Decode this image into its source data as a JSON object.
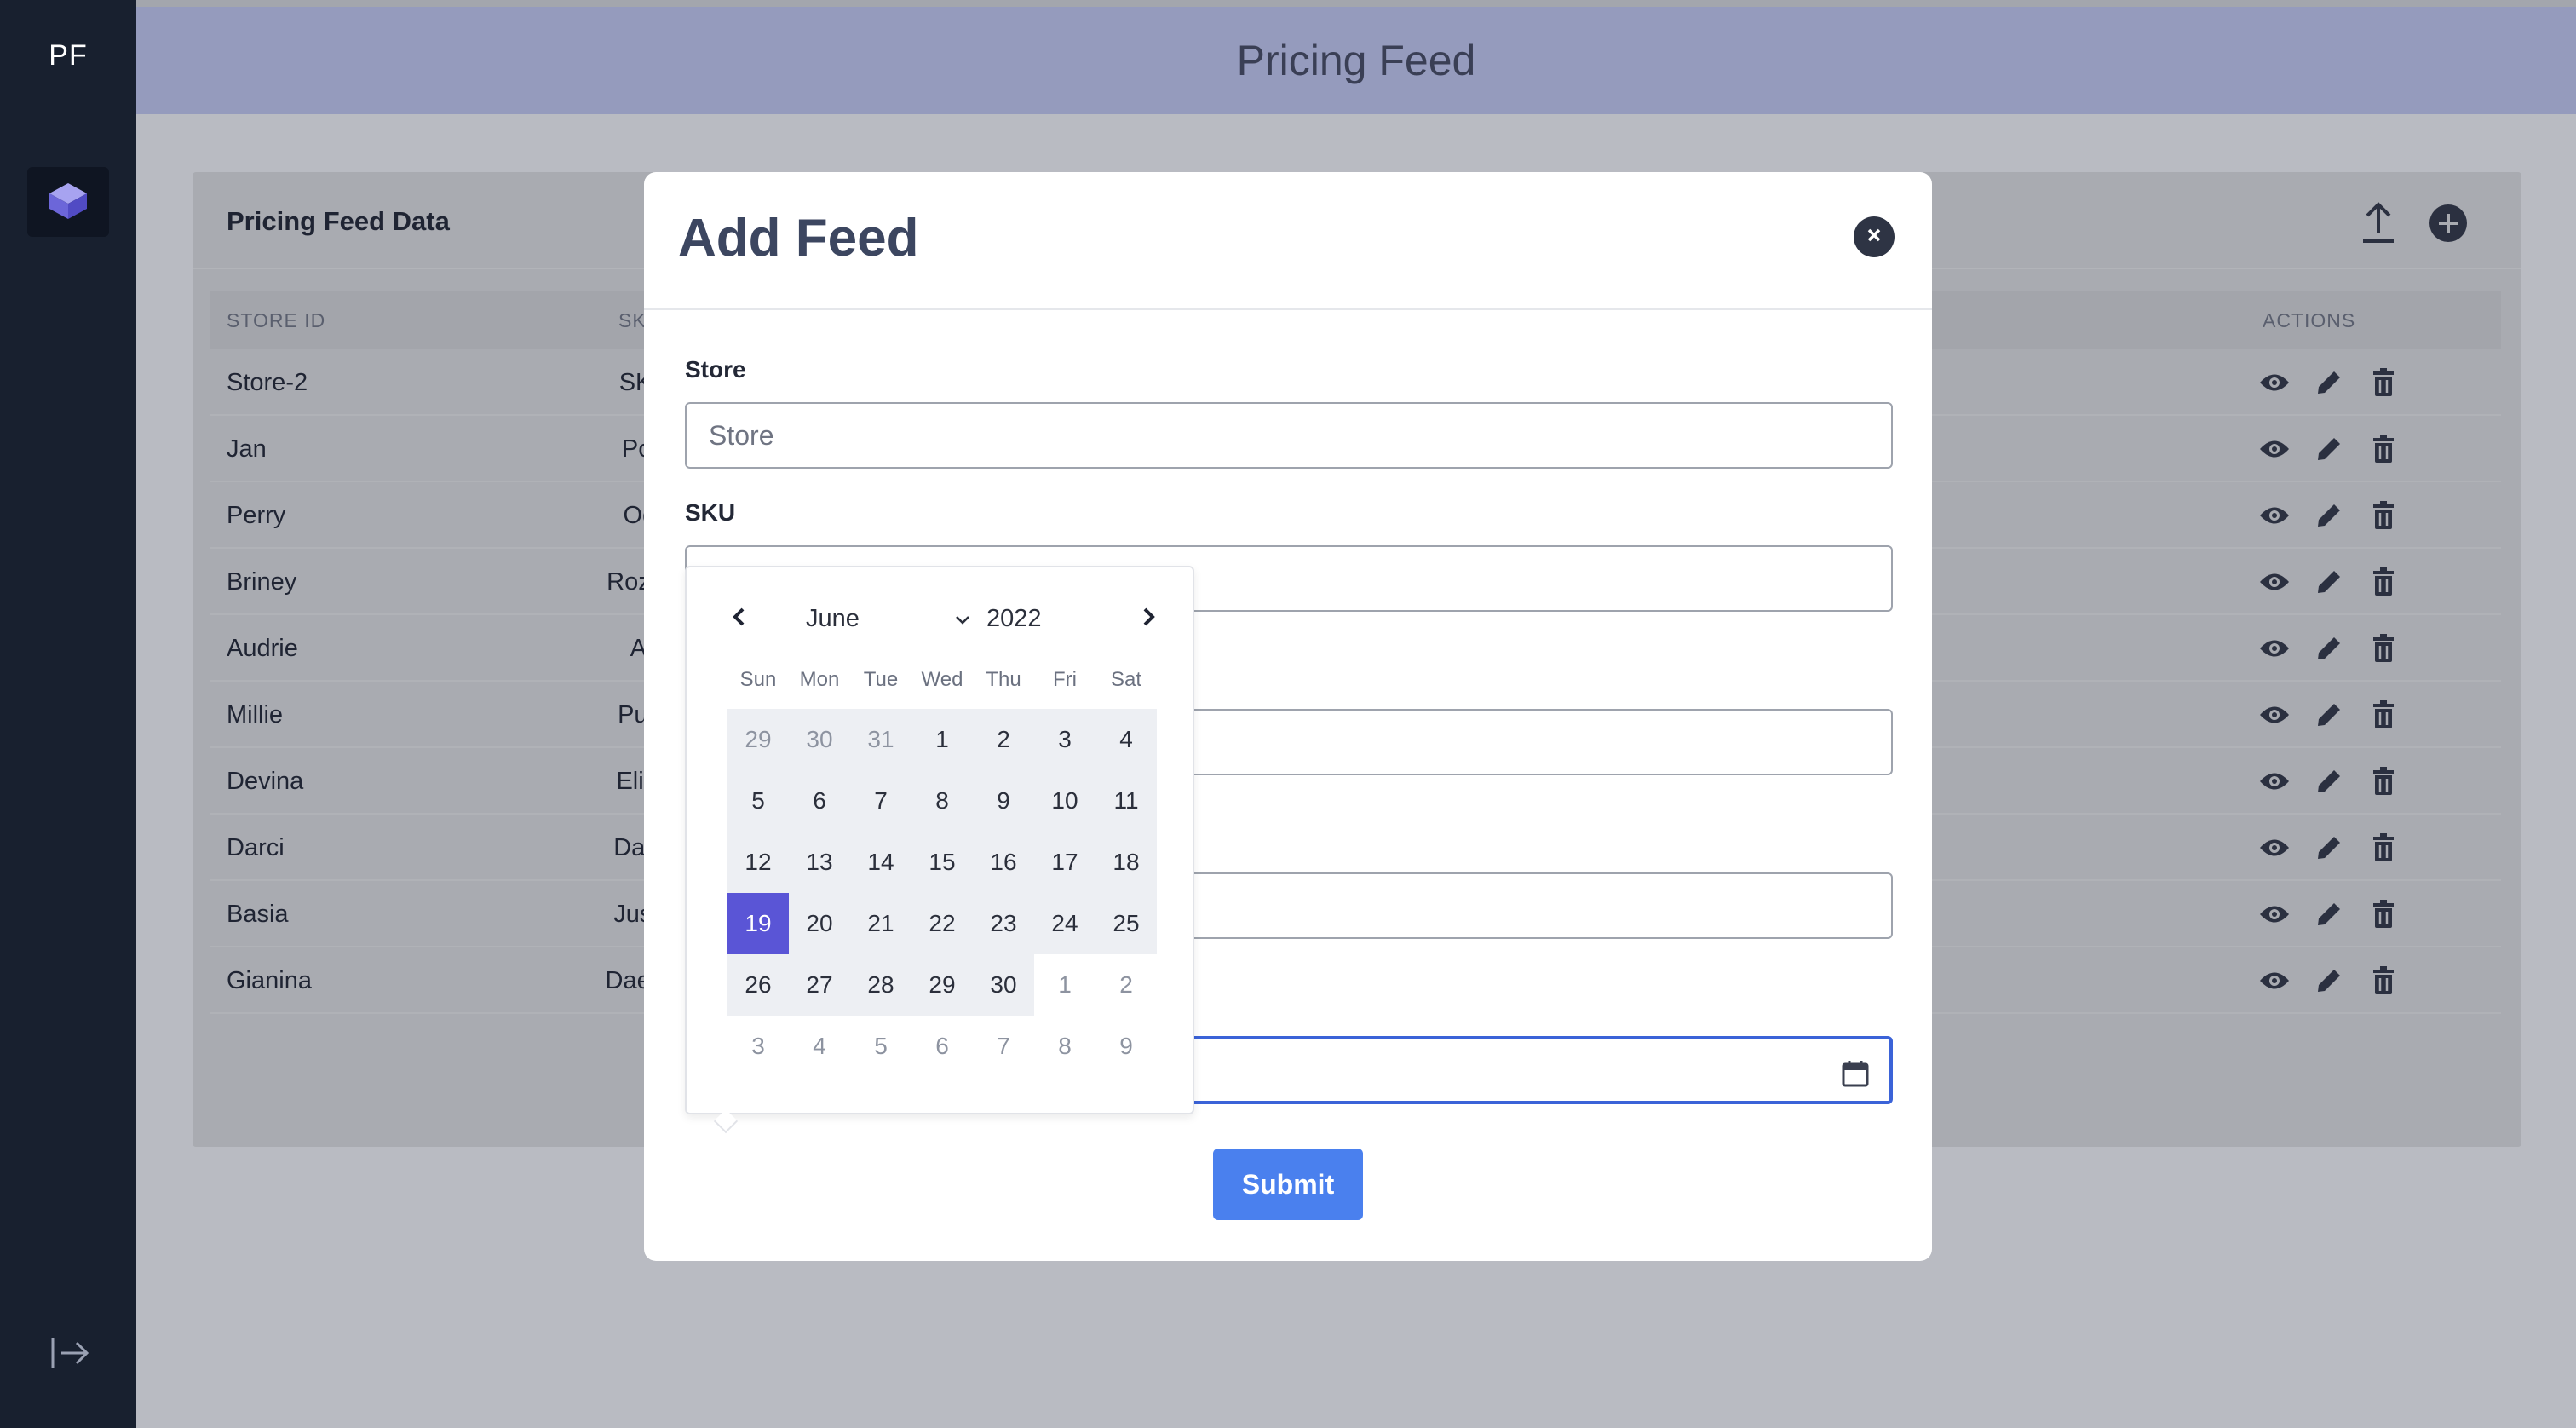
{
  "sidebar": {
    "brand": "PF",
    "nav_icon": "cube-icon",
    "logout_icon": "logout-arrow-icon"
  },
  "header": {
    "title": "Pricing Feed"
  },
  "card": {
    "title": "Pricing Feed Data",
    "columns": {
      "store_id": "STORE ID",
      "sku": "SKU",
      "actions": "ACTIONS"
    },
    "rows": [
      {
        "store": "Store-2",
        "sku": "SKU-"
      },
      {
        "store": "Jan",
        "sku": "Ponc"
      },
      {
        "store": "Perry",
        "sku": "Ogre"
      },
      {
        "store": "Briney",
        "sku": "Rozan"
      },
      {
        "store": "Audrie",
        "sku": "Ajay"
      },
      {
        "store": "Millie",
        "sku": "Pulsif"
      },
      {
        "store": "Devina",
        "sku": "Eliath"
      },
      {
        "store": "Darci",
        "sku": "Davet"
      },
      {
        "store": "Basia",
        "sku": "Justin"
      },
      {
        "store": "Gianina",
        "sku": "Daega"
      }
    ]
  },
  "modal": {
    "title": "Add Feed",
    "store_label": "Store",
    "store_placeholder": "Store",
    "sku_label": "SKU",
    "submit_label": "Submit"
  },
  "datepicker": {
    "month": "June",
    "year": "2022",
    "weekdays": [
      "Sun",
      "Mon",
      "Tue",
      "Wed",
      "Thu",
      "Fri",
      "Sat"
    ],
    "weeks": [
      [
        "29",
        "30",
        "31",
        "1",
        "2",
        "3",
        "4"
      ],
      [
        "5",
        "6",
        "7",
        "8",
        "9",
        "10",
        "11"
      ],
      [
        "12",
        "13",
        "14",
        "15",
        "16",
        "17",
        "18"
      ],
      [
        "19",
        "20",
        "21",
        "22",
        "23",
        "24",
        "25"
      ],
      [
        "26",
        "27",
        "28",
        "29",
        "30",
        "1",
        "2"
      ],
      [
        "3",
        "4",
        "5",
        "6",
        "7",
        "8",
        "9"
      ]
    ],
    "selected": "19"
  },
  "colors": {
    "sidebar": "#18202f",
    "header": "#959bbd",
    "accent": "#4a80ee",
    "selected_day": "#5a55d6"
  }
}
